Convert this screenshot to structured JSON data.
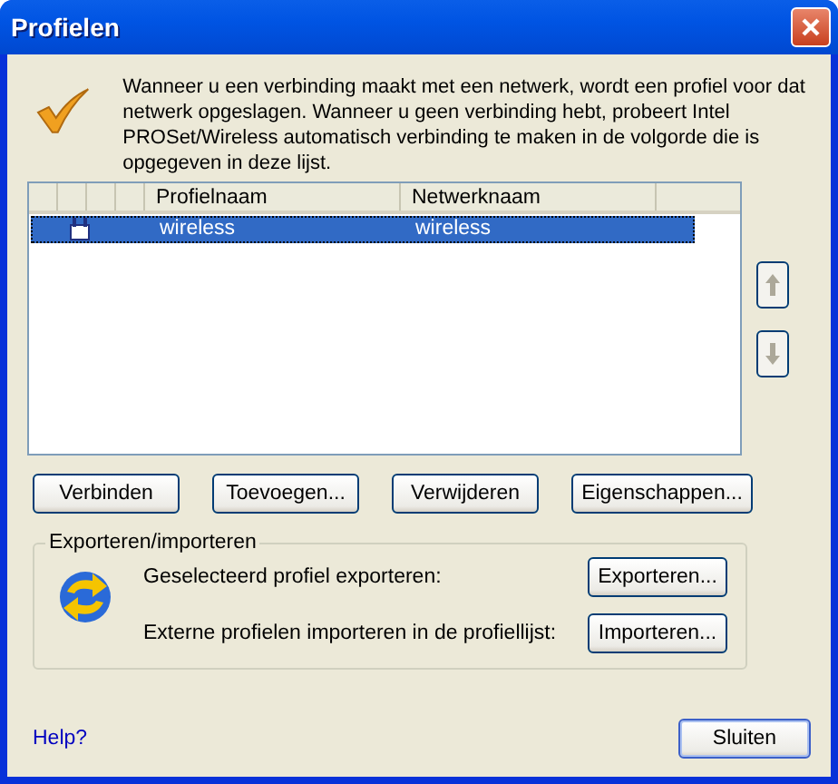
{
  "window": {
    "title": "Profielen"
  },
  "intro": "Wanneer u een verbinding maakt met een netwerk, wordt een profiel voor dat netwerk opgeslagen. Wanneer u geen verbinding hebt, probeert Intel PROSet/Wireless automatisch verbinding te maken in de volgorde die is opgegeven in deze lijst.",
  "table": {
    "columns": [
      "Profielnaam",
      "Netwerknaam"
    ],
    "rows": [
      {
        "profile": "wireless",
        "network": "wireless",
        "selected": true
      }
    ]
  },
  "move_buttons": [
    {
      "kind": "up",
      "disabled": true
    },
    {
      "kind": "down",
      "disabled": true
    }
  ],
  "buttons": [
    "Verbinden",
    "Toevoegen...",
    "Verwijderen",
    "Eigenschappen..."
  ],
  "export_import": {
    "title": "Exporteren/importeren",
    "rows": [
      {
        "label": "Geselecteerd profiel exporteren:",
        "button": "Exporteren..."
      },
      {
        "label": "Externe profielen importeren in de profiellijst:",
        "button": "Importeren..."
      }
    ]
  },
  "help": "Help?",
  "close_button": "Sluiten"
}
